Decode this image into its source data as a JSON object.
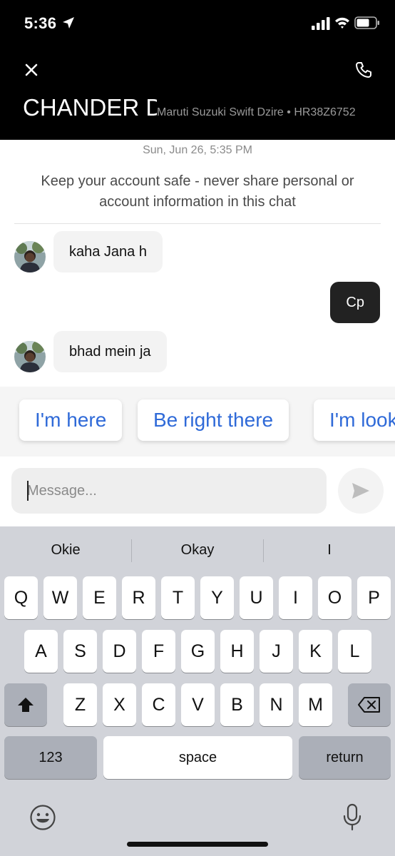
{
  "status_bar": {
    "time": "5:36"
  },
  "header": {
    "driver_name": "CHANDER DAS",
    "vehicle": "Maruti Suzuki Swift Dzire • HR38Z6752"
  },
  "chat": {
    "date": "Sun, Jun 26, 5:35 PM",
    "safety_note": "Keep your account safe - never share personal or account information in this chat",
    "messages": [
      {
        "from": "driver",
        "text": "kaha Jana h"
      },
      {
        "from": "me",
        "text": "Cp"
      },
      {
        "from": "driver",
        "text": "bhad mein ja"
      }
    ]
  },
  "quick_replies": [
    "I'm here",
    "Be right there",
    "I'm looking"
  ],
  "composer": {
    "placeholder": "Message..."
  },
  "keyboard": {
    "suggestions": [
      "Okie",
      "Okay",
      "I"
    ],
    "row1": [
      "Q",
      "W",
      "E",
      "R",
      "T",
      "Y",
      "U",
      "I",
      "O",
      "P"
    ],
    "row2": [
      "A",
      "S",
      "D",
      "F",
      "G",
      "H",
      "J",
      "K",
      "L"
    ],
    "row3": [
      "Z",
      "X",
      "C",
      "V",
      "B",
      "N",
      "M"
    ],
    "numbers_label": "123",
    "space_label": "space",
    "return_label": "return"
  },
  "colors": {
    "accent": "#2f6ad8",
    "header_bg": "#000000",
    "outgoing_bubble": "#222222"
  }
}
